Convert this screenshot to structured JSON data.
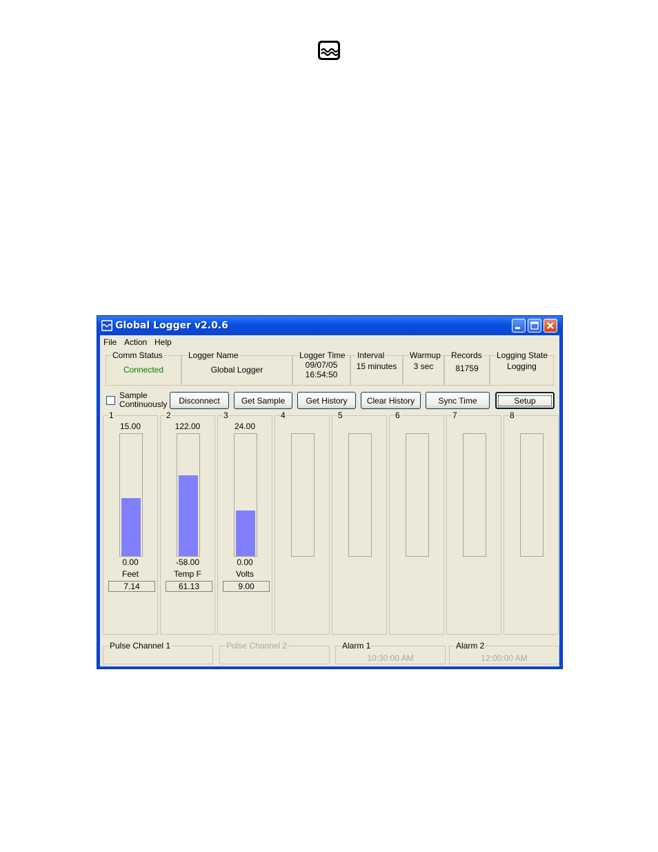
{
  "window": {
    "title": "Global Logger v2.0.6"
  },
  "menu": [
    "File",
    "Action",
    "Help"
  ],
  "status": {
    "comm_status": {
      "label": "Comm Status",
      "value": "Connected",
      "color": "#008000"
    },
    "logger_name": {
      "label": "Logger Name",
      "value": "Global Logger"
    },
    "logger_time": {
      "label": "Logger Time",
      "date": "09/07/05",
      "time": "16:54:50"
    },
    "interval": {
      "label": "Interval",
      "value": "15 minutes"
    },
    "warmup": {
      "label": "Warmup",
      "value": "3 sec"
    },
    "records": {
      "label": "Records",
      "value": "81759"
    },
    "logging_state": {
      "label": "Logging State",
      "value": "Logging"
    }
  },
  "controls": {
    "sample_continuously": {
      "label_line1": "Sample",
      "label_line2": "Continuously",
      "checked": false
    },
    "buttons": {
      "disconnect": "Disconnect",
      "get_sample": "Get Sample",
      "get_history": "Get History",
      "clear_history": "Clear History",
      "sync_time": "Sync Time",
      "setup": "Setup"
    }
  },
  "channels": [
    {
      "num": "1",
      "max": "15.00",
      "min": "0.00",
      "unit": "Feet",
      "reading": "7.14",
      "level": 0.476
    },
    {
      "num": "2",
      "max": "122.00",
      "min": "-58.00",
      "unit": "Temp F",
      "reading": "61.13",
      "level": 0.662
    },
    {
      "num": "3",
      "max": "24.00",
      "min": "0.00",
      "unit": "Volts",
      "reading": "9.00",
      "level": 0.375
    },
    {
      "num": "4"
    },
    {
      "num": "5"
    },
    {
      "num": "6"
    },
    {
      "num": "7"
    },
    {
      "num": "8"
    }
  ],
  "bottom": {
    "pulse1": {
      "label": "Pulse Channel 1"
    },
    "pulse2": {
      "label": "Pulse Channel 2"
    },
    "alarm1": {
      "label": "Alarm 1",
      "value": "10:30:00 AM"
    },
    "alarm2": {
      "label": "Alarm 2",
      "value": "12:00:00 AM"
    }
  },
  "colors": {
    "gauge_fill": "#8080ff",
    "connected": "#008000",
    "titlebar": "#0a4ee0"
  },
  "icons": [
    "water-wave-logo-icon",
    "app-icon",
    "minimize-icon",
    "maximize-icon",
    "close-icon"
  ]
}
